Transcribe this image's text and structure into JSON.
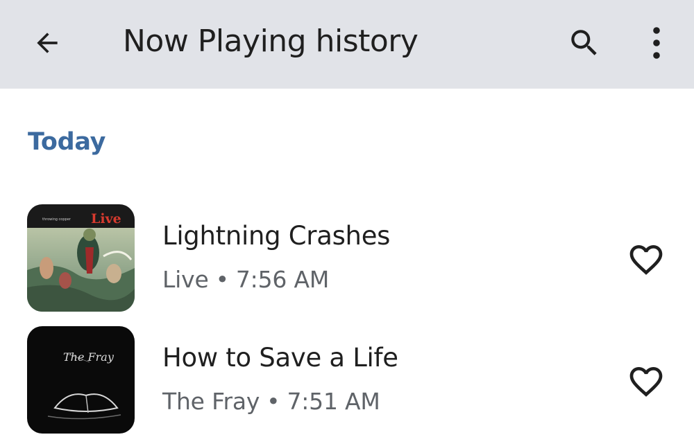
{
  "appbar": {
    "title": "Now Playing history",
    "back_icon": "arrow-back-icon",
    "search_icon": "search-icon",
    "more_icon": "more-vert-icon",
    "background": "#e1e3e8"
  },
  "section": {
    "label": "Today",
    "color": "#3c6a9f"
  },
  "songs": [
    {
      "title": "Lightning Crashes",
      "artist": "Live",
      "time": "7:56 AM",
      "separator": "•",
      "art_text": "Live",
      "art_caption": "throwing copper",
      "favorite_icon": "heart-outline-icon"
    },
    {
      "title": "How to Save a Life",
      "artist": "The Fray",
      "time": "7:51 AM",
      "separator": "•",
      "art_text": "The Fray",
      "art_caption": "",
      "favorite_icon": "heart-outline-icon"
    }
  ]
}
